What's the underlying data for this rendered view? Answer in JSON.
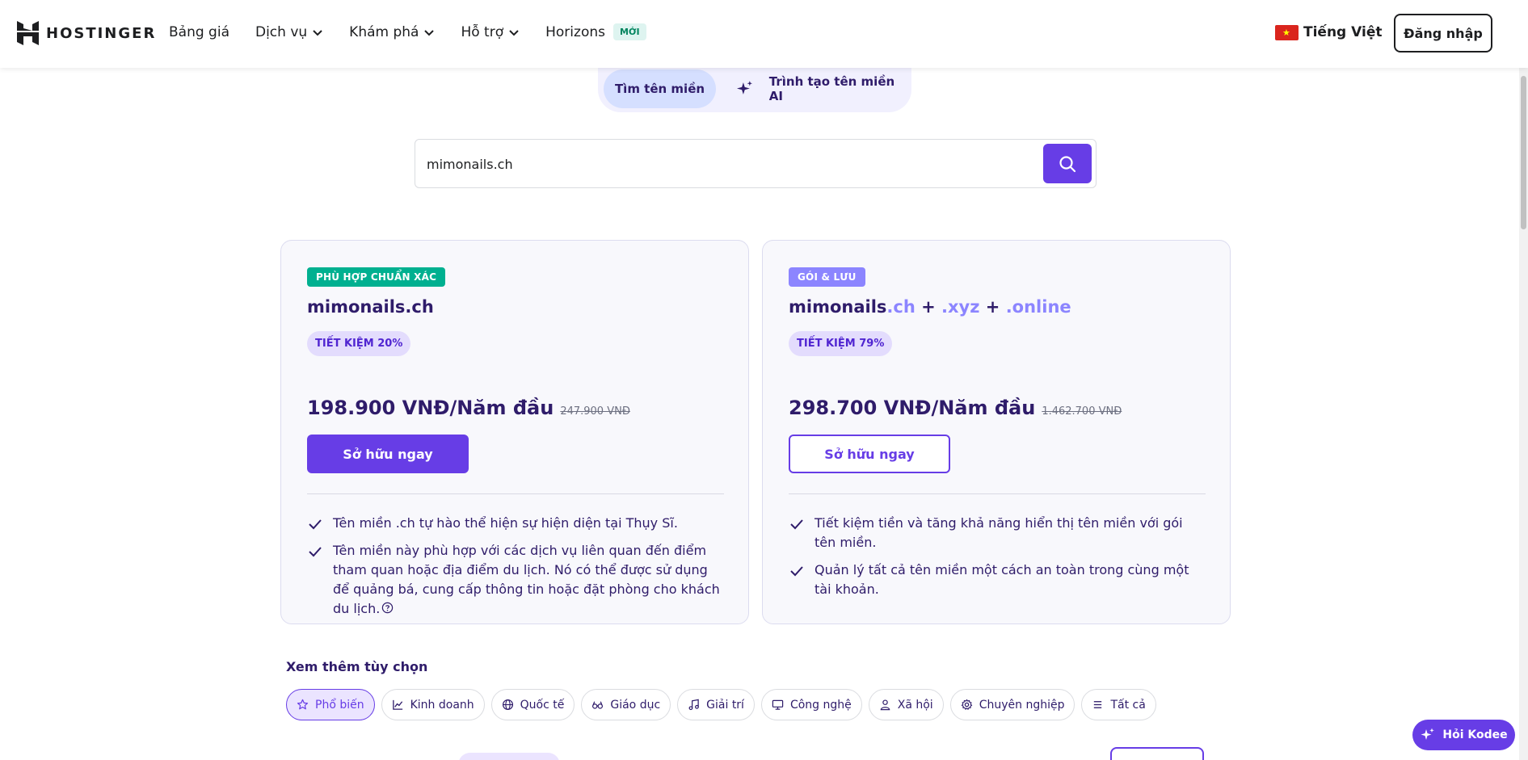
{
  "header": {
    "logo_text": "HOSTINGER",
    "nav": {
      "pricing": "Bảng giá",
      "services": "Dịch vụ",
      "explore": "Khám phá",
      "support": "Hỗ trợ",
      "horizons": "Horizons",
      "new_badge": "MỚI"
    },
    "language": "Tiếng Việt",
    "login": "Đăng nhập"
  },
  "tabs": {
    "find_domain": "Tìm tên miền",
    "ai_generator": "Trình tạo tên miền AI"
  },
  "search": {
    "value": "mimonails.ch"
  },
  "cards": {
    "exact": {
      "badge": "PHÙ HỢP CHUẨN XÁC",
      "domain": "mimonails.ch",
      "savings": "TIẾT KIỆM 20%",
      "price": "198.900 VNĐ/Năm đầu",
      "old_price": "247.900 VNĐ",
      "button": "Sở hữu ngay",
      "features": [
        "Tên miền .ch tự hào thể hiện sự hiện diện tại Thụy Sĩ.",
        "Tên miền này phù hợp với các dịch vụ liên quan đến điểm tham quan hoặc địa điểm du lịch. Nó có thể được sử dụng để quảng bá, cung cấp thông tin hoặc đặt phòng cho khách du lịch."
      ]
    },
    "bundle": {
      "badge": "GÓI & LƯU",
      "domain_base": "mimonails",
      "tld1": ".ch",
      "plus": "+",
      "tld2": ".xyz",
      "tld3": ".online",
      "savings": "TIẾT KIỆM 79%",
      "price": "298.700 VNĐ/Năm đầu",
      "old_price": "1.462.700 VNĐ",
      "button": "Sở hữu ngay",
      "features": [
        "Tiết kiệm tiền và tăng khả năng hiển thị tên miền với gói tên miền.",
        "Quản lý tất cả tên miền một cách an toàn trong cùng một tài khoản."
      ]
    }
  },
  "more_options": {
    "title": "Xem thêm tùy chọn",
    "chips": [
      "Phổ biến",
      "Kinh doanh",
      "Quốc tế",
      "Giáo dục",
      "Giải trí",
      "Công nghệ",
      "Xã hội",
      "Chuyên nghiệp",
      "Tất cả"
    ]
  },
  "kodee": {
    "label": "Hỏi Kodee"
  },
  "colors": {
    "primary": "#673de6",
    "dark_text": "#2f1c6a",
    "green_badge": "#00b090",
    "purple_badge": "#8c85ff"
  }
}
